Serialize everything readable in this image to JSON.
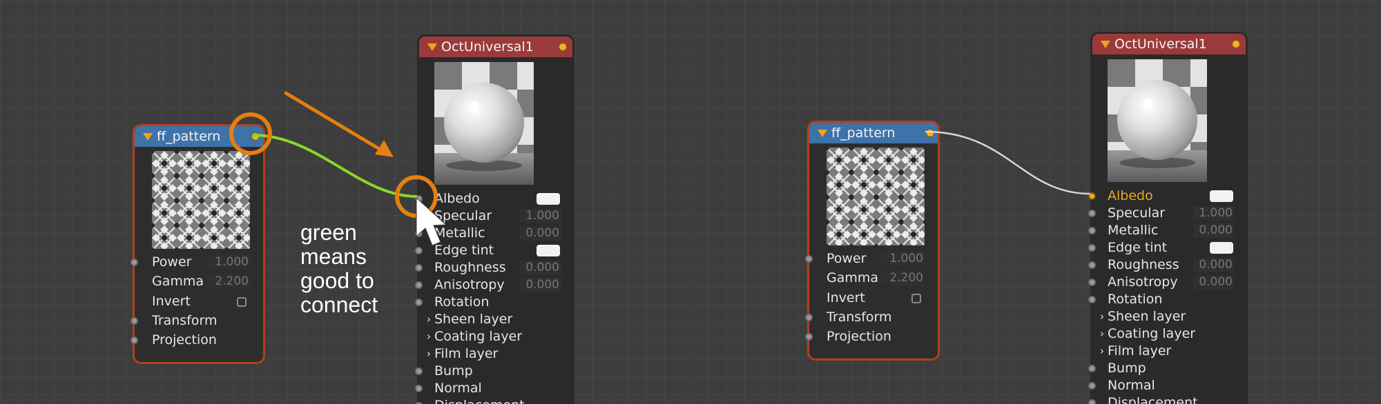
{
  "colors": {
    "canvas": "#3d3d3d",
    "node_outline_selected": "#b3401b",
    "pattern_header": "#3d73a8",
    "material_header": "#9b3a3a",
    "output_pin": "#f0b02c",
    "good_connection_wire": "#8ed62a",
    "connected_wire": "#d8d8d8",
    "highlighted_pin_label": "#eba52a",
    "annotation": "#e57f10"
  },
  "annotation": {
    "line1": "green",
    "line2": "means",
    "line3": "good to",
    "line4": "connect"
  },
  "left": {
    "pattern_node": {
      "title": "ff_pattern",
      "params": [
        {
          "label": "Power",
          "value": "1.000"
        },
        {
          "label": "Gamma",
          "value": "2.200"
        },
        {
          "label": "Invert"
        },
        {
          "label": "Transform"
        },
        {
          "label": "Projection"
        }
      ]
    },
    "material_node": {
      "title": "OctUniversal1",
      "pins": [
        {
          "label": "Albedo"
        },
        {
          "label": "Specular",
          "value": "1.000"
        },
        {
          "label": "Metallic",
          "value": "0.000"
        },
        {
          "label": "Edge tint"
        },
        {
          "label": "Roughness",
          "value": "0.000"
        },
        {
          "label": "Anisotropy",
          "value": "0.000"
        },
        {
          "label": "Rotation"
        },
        {
          "label": "Sheen layer"
        },
        {
          "label": "Coating layer"
        },
        {
          "label": "Film layer"
        },
        {
          "label": "Bump"
        },
        {
          "label": "Normal"
        },
        {
          "label": "Displacement"
        }
      ]
    }
  },
  "right": {
    "pattern_node": {
      "title": "ff_pattern",
      "params": [
        {
          "label": "Power",
          "value": "1.000"
        },
        {
          "label": "Gamma",
          "value": "2.200"
        },
        {
          "label": "Invert"
        },
        {
          "label": "Transform"
        },
        {
          "label": "Projection"
        }
      ]
    },
    "material_node": {
      "title": "OctUniversal1",
      "pins": [
        {
          "label": "Albedo"
        },
        {
          "label": "Specular",
          "value": "1.000"
        },
        {
          "label": "Metallic",
          "value": "0.000"
        },
        {
          "label": "Edge tint"
        },
        {
          "label": "Roughness",
          "value": "0.000"
        },
        {
          "label": "Anisotropy",
          "value": "0.000"
        },
        {
          "label": "Rotation"
        },
        {
          "label": "Sheen layer"
        },
        {
          "label": "Coating layer"
        },
        {
          "label": "Film layer"
        },
        {
          "label": "Bump"
        },
        {
          "label": "Normal"
        },
        {
          "label": "Displacement"
        }
      ]
    }
  }
}
